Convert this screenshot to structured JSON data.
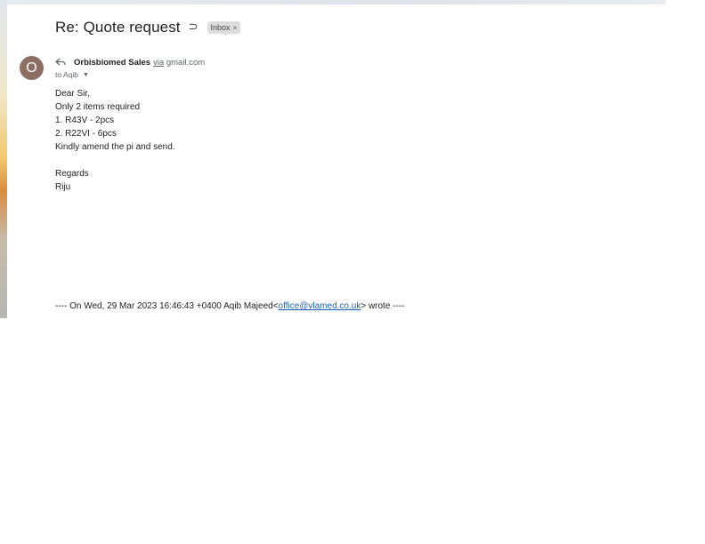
{
  "email": {
    "subject": "Re: Quote request",
    "importance_glyph": "⊃",
    "label": "Inbox",
    "label_close": "×",
    "avatar_letter": "O",
    "sender_name": "Orbisbiomed Sales",
    "via_prefix": "via",
    "via_domain": "gmail.com",
    "to_line": "to Aqib",
    "to_caret": "▼",
    "body": [
      "Dear Sir,",
      "Only 2 items required",
      "1. R43V - 2pcs",
      "2. R22VI - 6pcs",
      "Kindly amend the pi and send.",
      "",
      "Regards",
      "Riju"
    ],
    "quote_prefix": "---- On Wed, 29 Mar 2023 16:46:43 +0400 Aqib Majeed<",
    "quote_email": "office@vlamed.co.uk",
    "quote_suffix": "> wrote ----"
  },
  "icons": {
    "reply": "reply-icon",
    "importance": "importance-marker-icon",
    "avatar": "avatar"
  },
  "colors": {
    "avatar_bg": "#8d6e63",
    "link": "#1a5fb4",
    "chip_bg": "#dddddd"
  }
}
